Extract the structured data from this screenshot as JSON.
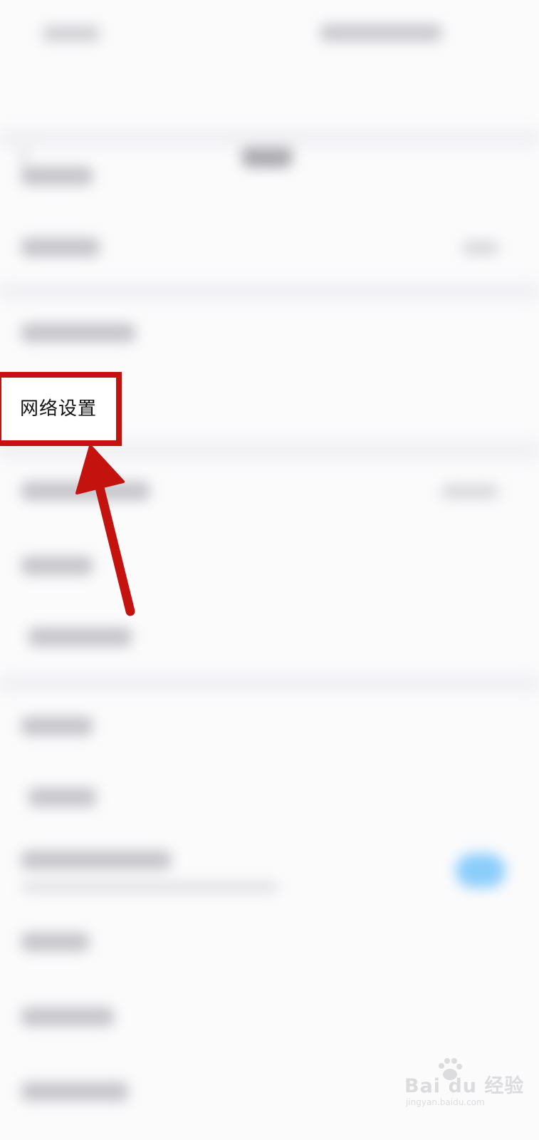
{
  "annotation": {
    "highlight_label": "网络设置",
    "box_color": "#c4120e",
    "arrow_color": "#c4120e"
  },
  "toggle": {
    "state": "on",
    "color": "#8ccdfb"
  },
  "watermark": {
    "brand": "Bai du 经验",
    "url": "jingyan.baidu.com"
  },
  "icons": {
    "back": "back-arrow-icon",
    "paw": "baidu-paw-icon"
  }
}
